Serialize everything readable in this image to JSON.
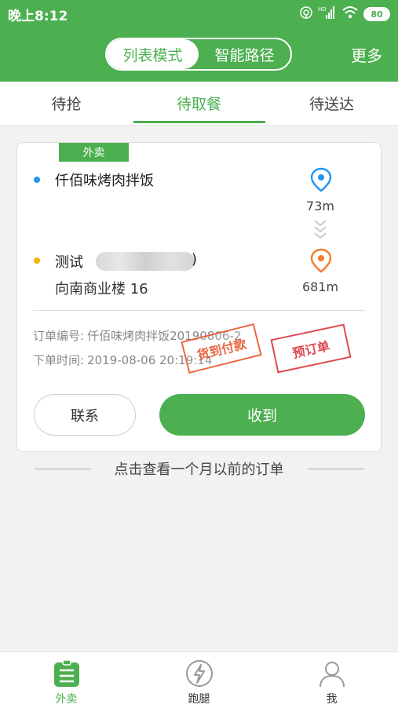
{
  "status_bar": {
    "time": "晚上8:12",
    "battery": "80",
    "signal_tag": "HD"
  },
  "header": {
    "mode_tabs": [
      {
        "label": "列表模式",
        "active": true
      },
      {
        "label": "智能路径",
        "active": false
      }
    ],
    "more_label": "更多"
  },
  "tabs": [
    {
      "label": "待抢",
      "active": false
    },
    {
      "label": "待取餐",
      "active": true
    },
    {
      "label": "待送达",
      "active": false
    }
  ],
  "order": {
    "tag": "外卖",
    "shop_name": "仟佰味烤肉拌饭",
    "shop_distance": "73m",
    "customer_name": "测试",
    "customer_paren": ")",
    "customer_address": "向南商业楼 16",
    "customer_distance": "681m",
    "order_no_label": "订单编号:",
    "order_no_value": "仟佰味烤肉拌饭20190806-2",
    "order_time_label": "下单时间:",
    "order_time_value": "2019-08-06 20:19:14",
    "stamp_cod": "货到付款",
    "stamp_preorder": "预订单",
    "contact_label": "联系",
    "received_label": "收到"
  },
  "history_link": "点击查看一个月以前的订单",
  "bottom_nav": [
    {
      "label": "外卖",
      "icon": "list-icon",
      "active": true
    },
    {
      "label": "跑腿",
      "icon": "lightning-icon",
      "active": false
    },
    {
      "label": "我",
      "icon": "person-icon",
      "active": false
    }
  ],
  "colors": {
    "brand": "#4caf50",
    "pin_blue": "#2196f3",
    "pin_orange": "#f47c2a",
    "stamp_red": "#e8572e"
  }
}
